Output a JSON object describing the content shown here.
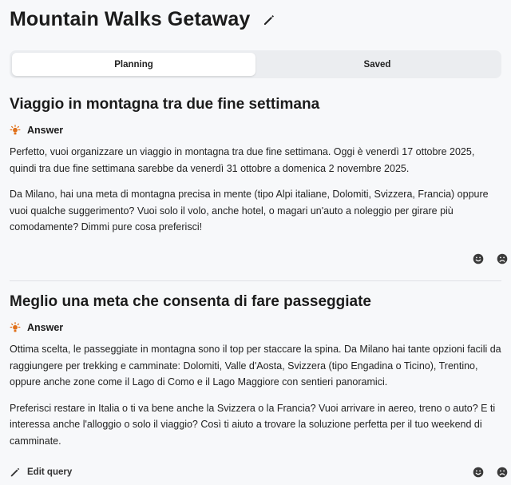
{
  "title": "Mountain Walks Getaway",
  "tabs": [
    {
      "label": "Planning",
      "active": true
    },
    {
      "label": "Saved",
      "active": false
    }
  ],
  "answer_label": "Answer",
  "qa": [
    {
      "question": "Viaggio in montagna tra due fine settimana",
      "paragraphs": [
        "Perfetto, vuoi organizzare un viaggio in montagna tra due fine settimana. Oggi è venerdì 17 ottobre 2025, quindi tra due fine settimana sarebbe da venerdì 31 ottobre a domenica 2 novembre 2025.",
        "Da Milano, hai una meta di montagna precisa in mente (tipo Alpi italiane, Dolomiti, Svizzera, Francia) oppure vuoi qualche suggerimento? Vuoi solo il volo, anche hotel, o magari un'auto a noleggio per girare più comodamente? Dimmi pure cosa preferisci!"
      ]
    },
    {
      "question": "Meglio una meta che consenta di fare passeggiate",
      "paragraphs": [
        "Ottima scelta, le passeggiate in montagna sono il top per staccare la spina. Da Milano hai tante opzioni facili da raggiungere per trekking e camminate: Dolomiti, Valle d'Aosta, Svizzera (tipo Engadina o Ticino), Trentino, oppure anche zone come il Lago di Como e il Lago Maggiore con sentieri panoramici.",
        "Preferisci restare in Italia o ti va bene anche la Svizzera o la Francia? Vuoi arrivare in aereo, treno o auto? E ti interessa anche l'alloggio o solo il viaggio? Così ti aiuto a trovare la soluzione perfetta per il tuo weekend di camminate."
      ]
    }
  ],
  "edit_query_label": "Edit query",
  "colors": {
    "accent_icon": "#e0701a",
    "background": "#f7f8fa"
  },
  "icons": [
    "pencil-icon",
    "lightbulb-icon",
    "smile-icon",
    "frown-icon"
  ]
}
